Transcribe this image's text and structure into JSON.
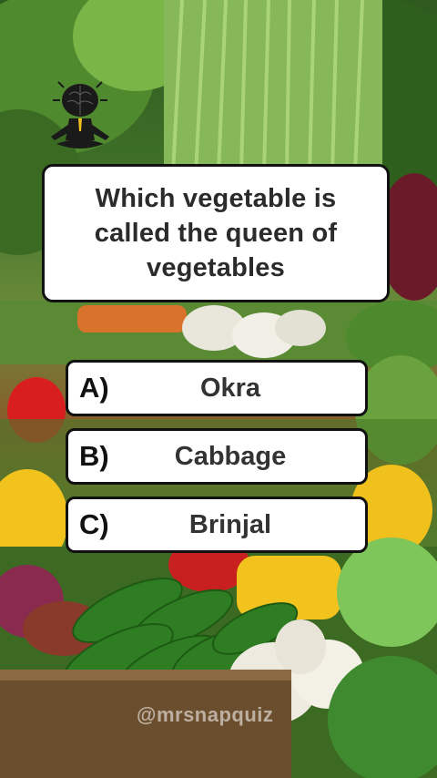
{
  "quiz": {
    "question": "Which vegetable is called the queen of vegetables",
    "options": [
      {
        "letter": "A)",
        "text": "Okra"
      },
      {
        "letter": "B)",
        "text": "Cabbage"
      },
      {
        "letter": "C)",
        "text": "Brinjal"
      }
    ]
  },
  "watermark": "@mrsnapquiz",
  "logo": {
    "icon": "meditating-brain-figure-icon"
  },
  "colors": {
    "card_bg": "#ffffff",
    "card_border": "#111111",
    "text": "#2b2b2b"
  }
}
